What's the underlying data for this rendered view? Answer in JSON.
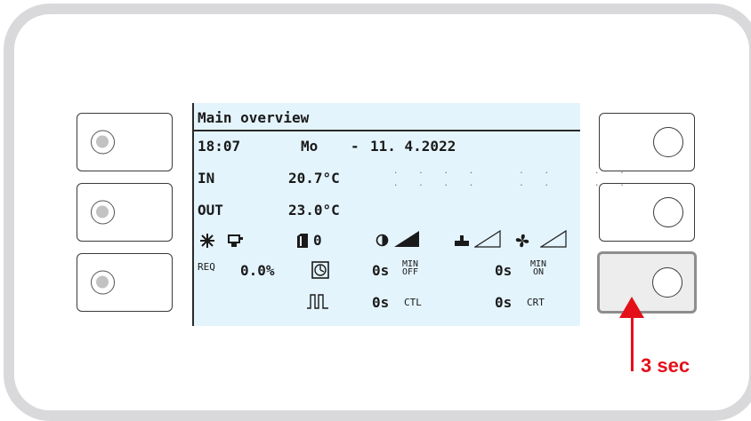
{
  "screen": {
    "title": "Main overview",
    "time": "18:07",
    "weekday": "Mo",
    "dash": "-",
    "date": "11. 4.2022",
    "in_label": "IN",
    "in_value": "20.7°C",
    "out_label": "OUT",
    "out_value": "23.0°C",
    "status_zero": "0",
    "req_label": "REQ",
    "req_value": "0.0%",
    "min_off_time": "0s",
    "min_off_label_top": "MIN",
    "min_off_label_bottom": "OFF",
    "min_on_time": "0s",
    "min_on_label_top": "MIN",
    "min_on_label_bottom": "ON",
    "ctl_time": "0s",
    "ctl_label": "CTL",
    "crt_time": "0s",
    "crt_label": "CRT"
  },
  "annotation": {
    "hold_label": "3 sec",
    "color": "#e3101a"
  },
  "icons": [
    "snowflake-icon",
    "compressor-icon",
    "stage-icon",
    "half-circle-icon",
    "ramp-filled-icon",
    "pump-icon",
    "ramp-outline-icon",
    "fan-icon",
    "timer-icon",
    "pulse-icon"
  ]
}
